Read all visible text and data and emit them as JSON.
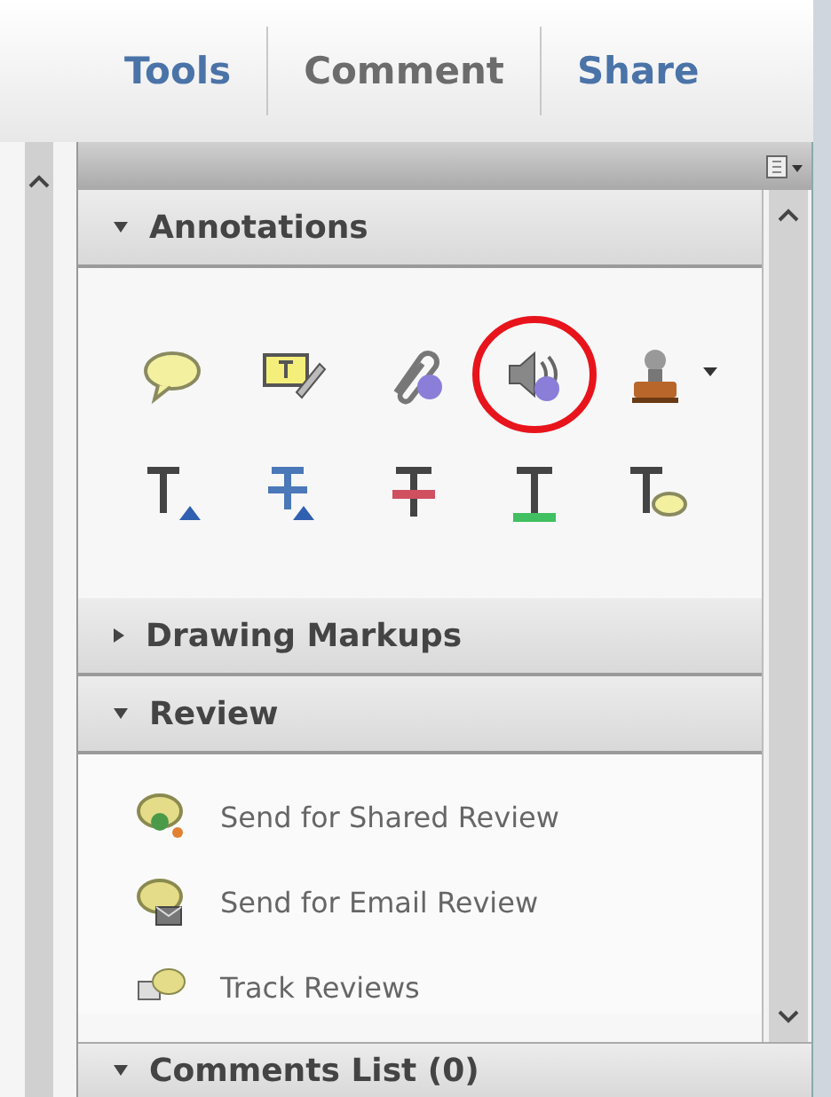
{
  "tabs": [
    {
      "label": "Tools",
      "selected": false
    },
    {
      "label": "Comment",
      "selected": true
    },
    {
      "label": "Share",
      "selected": false
    }
  ],
  "sections": [
    {
      "title": "Annotations",
      "expanded": true,
      "tools": [
        {
          "kind": "note",
          "highlighted": false
        },
        {
          "kind": "text-box",
          "highlighted": false
        },
        {
          "kind": "attach",
          "highlighted": false
        },
        {
          "kind": "sound",
          "highlighted": true
        },
        {
          "kind": "stamp",
          "highlighted": false
        },
        {
          "kind": "insert",
          "highlighted": false
        },
        {
          "kind": "replace",
          "highlighted": false
        },
        {
          "kind": "strike",
          "highlighted": false
        },
        {
          "kind": "underline",
          "highlighted": false
        },
        {
          "kind": "text-note",
          "highlighted": false
        }
      ]
    },
    {
      "title": "Drawing Markups",
      "expanded": false
    },
    {
      "title": "Review",
      "expanded": true,
      "items": [
        {
          "kind": "shared",
          "label": "Send for Shared Review"
        },
        {
          "kind": "email",
          "label": "Send for Email Review"
        },
        {
          "kind": "track",
          "label": "Track Reviews"
        }
      ]
    },
    {
      "title": "Comments List (0)",
      "expanded": true
    }
  ]
}
